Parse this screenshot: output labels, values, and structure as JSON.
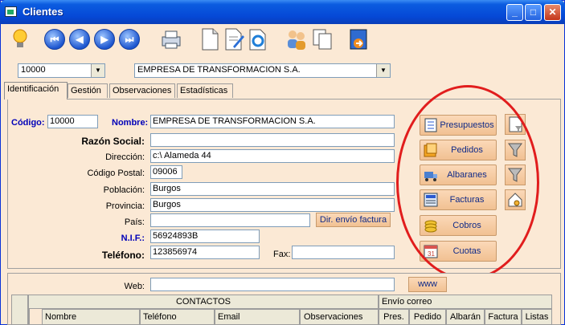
{
  "window": {
    "title": "Clientes",
    "controls": [
      "_",
      "□",
      "✕"
    ]
  },
  "toolbar": {
    "nav": [
      "⏮",
      "◀",
      "▶",
      "⏭"
    ],
    "icons": [
      "lightbulb-icon",
      "print-icon",
      "new-document-icon",
      "edit-document-icon",
      "refresh-icon",
      "users-icon",
      "copy-icon",
      "exit-icon"
    ]
  },
  "header": {
    "code_select": "10000",
    "company_select": "EMPRESA DE TRANSFORMACION S.A."
  },
  "tabs": [
    {
      "label": "Identificación",
      "active": true
    },
    {
      "label": "Gestión"
    },
    {
      "label": "Observaciones"
    },
    {
      "label": "Estadísticas"
    }
  ],
  "form": {
    "codigo_label": "Código:",
    "codigo_value": "10000",
    "nombre_label": "Nombre:",
    "nombre_value": "EMPRESA DE TRANSFORMACION S.A.",
    "razon_label": "Razón Social:",
    "razon_value": "",
    "direccion_label": "Dirección:",
    "direccion_value": "c:\\ Alameda 44",
    "cp_label": "Código Postal:",
    "cp_value": "09006",
    "poblacion_label": "Población:",
    "poblacion_value": "Burgos",
    "provincia_label": "Provincia:",
    "provincia_value": "Burgos",
    "pais_label": "País:",
    "pais_value": "",
    "dir_envio_label": "Dir. envío factura",
    "nif_label": "N.I.F.:",
    "nif_value": "56924893B",
    "telefono_label": "Teléfono:",
    "telefono_value": "123856974",
    "fax_label": "Fax:",
    "fax_value": "",
    "web_label": "Web:",
    "web_value": "",
    "www_label": "www"
  },
  "side_buttons": [
    "Presupuestos",
    "Pedidos",
    "Albaranes",
    "Facturas",
    "Cobros",
    "Cuotas"
  ],
  "contacts": {
    "header": "CONTACTOS",
    "envio_header": "Envío correo",
    "columns": [
      "Nombre",
      "Teléfono",
      "Email",
      "Observaciones"
    ],
    "envio_columns": [
      "Pres.",
      "Pedido",
      "Albarán",
      "Factura",
      "Listas"
    ]
  },
  "colors": {
    "window_bg": "#fbe9d5",
    "titlebar": "#0548d6",
    "highlight": "#e11d1d",
    "label_blue": "#0000b8"
  }
}
